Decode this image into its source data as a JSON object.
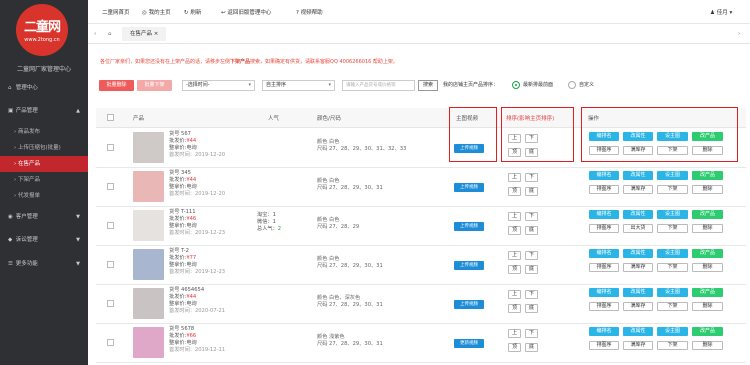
{
  "sidebar": {
    "logo_text": "二童网",
    "logo_url": "www.2tong.cn",
    "title": "二童网厂家管理中心",
    "items": [
      {
        "label": "管理中心",
        "icon": "home-icon"
      },
      {
        "label": "产品管理",
        "icon": "box-icon"
      },
      {
        "label": "商品发布"
      },
      {
        "label": "上传压缩包(批量)"
      },
      {
        "label": "在售产品"
      },
      {
        "label": "下架产品"
      },
      {
        "label": "代发报单"
      },
      {
        "label": "客户管理",
        "icon": "user-icon"
      },
      {
        "label": "诉讼管理",
        "icon": "gavel-icon"
      },
      {
        "label": "更多功能",
        "icon": "more-icon"
      }
    ]
  },
  "topbar": {
    "home": "二童网首页",
    "my_home": "我的主页",
    "refresh": "刷新",
    "old_admin": "返回旧版管理中心",
    "help": "视频帮助",
    "user": "佳月"
  },
  "tabs": {
    "active": "在售产品"
  },
  "notice": {
    "text_before": "各位厂家亲们，如果您还没有在上架产品的话，请移步左侧",
    "highlight": "下架产品",
    "text_after": "搜索，如果确定有供货，请联系客服QQ 4006266016 帮助上架。"
  },
  "toolbar": {
    "batch_delete": "批量删除",
    "batch_offshelf": "批量下架",
    "time_select": "-选择时间-",
    "order_select": "自主排序",
    "search_placeholder": "请输入产品货号或价格等",
    "search_button": "搜索",
    "display_label": "我的店铺主页产品排序：",
    "option_new": "最新排最前面",
    "option_custom": "自定义"
  },
  "table": {
    "headers": {
      "product": "产品",
      "popularity": "人气",
      "color_size": "颜色/尺码",
      "main_video": "主图视频",
      "sort": "排序(影响主页排序)",
      "ops": "操作"
    },
    "rows": [
      {
        "no": "货号 567",
        "wholesale": "批发价:",
        "wholesale_val": "¥44",
        "mix": "整拿价:",
        "mix_val": "电询",
        "time": "首发时间：2019-12-20",
        "pop": [],
        "color": "颜色 白色",
        "size": "尺码 27、28、29、30、31、32、33",
        "video": "上传视频",
        "thumb": "#cfc9c7"
      },
      {
        "no": "货号 345",
        "wholesale": "批发价:",
        "wholesale_val": "¥44",
        "mix": "整拿价:",
        "mix_val": "电询",
        "time": "首发时间：2019-12-20",
        "pop": [],
        "color": "颜色 白色",
        "size": "尺码 27、28、29、30、31",
        "video": "上传视频",
        "thumb": "#e9b7b5"
      },
      {
        "no": "货号 T-111",
        "wholesale": "批发价:",
        "wholesale_val": "¥46",
        "mix": "整拿价:",
        "mix_val": "电询",
        "time": "首发时间：2019-12-23",
        "pop": [
          "淘宝：1",
          "微信：1",
          "总人气："
        ],
        "pop_total": "2",
        "color": "颜色 白色",
        "size": "尺码 27、28、29",
        "video": "上传视频",
        "thumb": "#e5e2df"
      },
      {
        "no": "货号 T-2",
        "wholesale": "批发价:",
        "wholesale_val": "¥77",
        "mix": "整拿价:",
        "mix_val": "电询",
        "time": "首发时间：2019-12-23",
        "pop": [],
        "color": "颜色 白色",
        "size": "尺码 27、28、29、30、31",
        "video": "上传视频",
        "thumb": "#a9b6cf"
      },
      {
        "no": "货号 4654654",
        "wholesale": "批发价:",
        "wholesale_val": "¥44",
        "mix": "整拿价:",
        "mix_val": "电询",
        "time": "首发时间：2020-07-21",
        "pop": [],
        "color": "颜色 白色、深灰色",
        "size": "尺码 27、28、29、30、31",
        "video": "上传视频",
        "thumb": "#c9c3c4"
      },
      {
        "no": "货号 5678",
        "wholesale": "批发价:",
        "wholesale_val": "¥66",
        "mix": "整拿价:",
        "mix_val": "电询",
        "time": "首发时间：2019-12-11",
        "pop": [],
        "color": "颜色 浅紫色",
        "size": "尺码 27、28、29、30、31",
        "video": "更新视频",
        "thumb": "#e0a8c8"
      }
    ],
    "sort_buttons": {
      "up": "上",
      "down": "下",
      "top": "顶",
      "bottom": "底"
    },
    "op_buttons": {
      "rename": "编排名",
      "change_attr": "改属性",
      "set_cover": "设主图",
      "edit_product": "改产品",
      "pick_image": "排图序",
      "restock": "满库存",
      "off_shelf": "下架",
      "delete": "删除",
      "clearance": "出大货"
    }
  },
  "colors": {
    "accent": "#c1272d",
    "blue": "#2ab5e6",
    "green": "#2ecc71"
  }
}
